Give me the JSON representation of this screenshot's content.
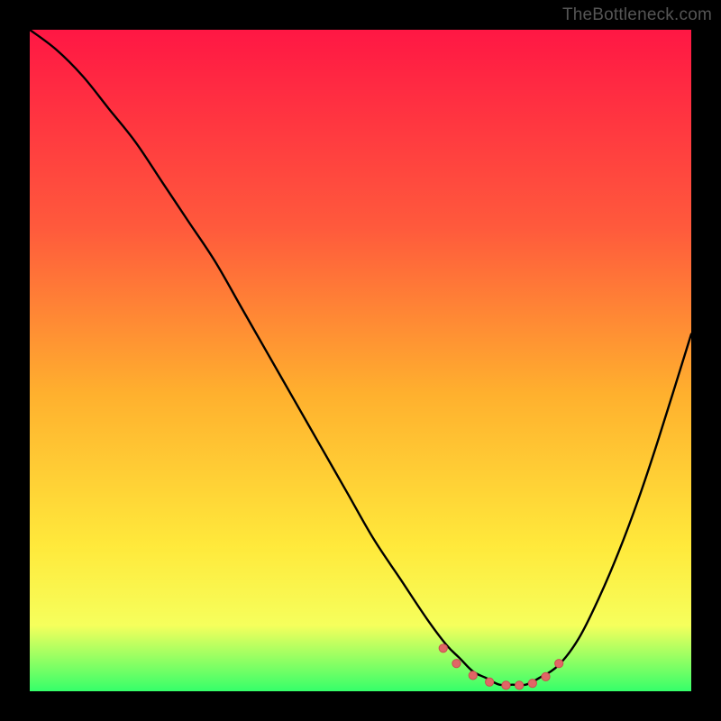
{
  "watermark": "TheBottleneck.com",
  "colors": {
    "background": "#000000",
    "curve": "#000000",
    "dots": "#e06666",
    "dots_stroke": "#c94f4f",
    "gradient_top": "#ff1744",
    "gradient_30": "#ff5a3c",
    "gradient_55": "#ffb02e",
    "gradient_78": "#ffe93b",
    "gradient_90": "#f6ff5c",
    "gradient_bottom": "#35ff6a"
  },
  "chart_data": {
    "type": "line",
    "title": "",
    "xlabel": "",
    "ylabel": "",
    "xlim": [
      0,
      100
    ],
    "ylim": [
      0,
      100
    ],
    "grid": false,
    "series": [
      {
        "name": "bottleneck-curve",
        "x": [
          0,
          4,
          8,
          12,
          16,
          20,
          24,
          28,
          32,
          36,
          40,
          44,
          48,
          52,
          56,
          60,
          63,
          65,
          67,
          69,
          71,
          73,
          75,
          77,
          80,
          83,
          86,
          89,
          92,
          95,
          100
        ],
        "values": [
          100,
          97,
          93,
          88,
          83,
          77,
          71,
          65,
          58,
          51,
          44,
          37,
          30,
          23,
          17,
          11,
          7,
          5,
          3,
          2,
          1,
          1,
          1,
          2,
          4,
          8,
          14,
          21,
          29,
          38,
          54
        ]
      }
    ],
    "markers": {
      "name": "flat-minimum-dots",
      "x": [
        62.5,
        64.5,
        67,
        69.5,
        72,
        74,
        76,
        78,
        80
      ],
      "values": [
        6.5,
        4.2,
        2.4,
        1.4,
        0.9,
        0.9,
        1.2,
        2.2,
        4.2
      ]
    }
  }
}
